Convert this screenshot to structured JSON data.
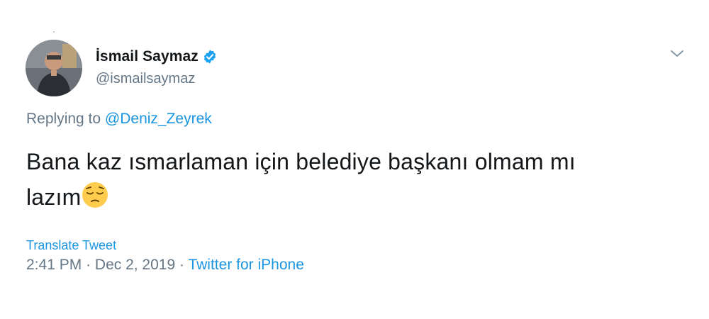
{
  "tweet": {
    "author": {
      "display_name": "İsmail Saymaz",
      "handle": "@ismailsaymaz",
      "verified": true,
      "verified_icon": "verified-badge-icon",
      "avatar_icon": "avatar-photo"
    },
    "menu_icon": "chevron-down-icon",
    "replying_prefix": "Replying to",
    "replying_mention": "@Deniz_Zeyrek",
    "text_line1": "Bana kaz ısmarlaman için belediye başkanı olmam mı",
    "text_line2": "lazım",
    "emoji": "pensive-face-emoji",
    "translate_label": "Translate Tweet",
    "time": "2:41 PM",
    "separator": "·",
    "date": "Dec 2, 2019",
    "source": "Twitter for iPhone"
  },
  "colors": {
    "link": "#1b95e0",
    "secondary_text": "#657786",
    "primary_text": "#14171a",
    "verified_blue": "#1da1f2"
  }
}
